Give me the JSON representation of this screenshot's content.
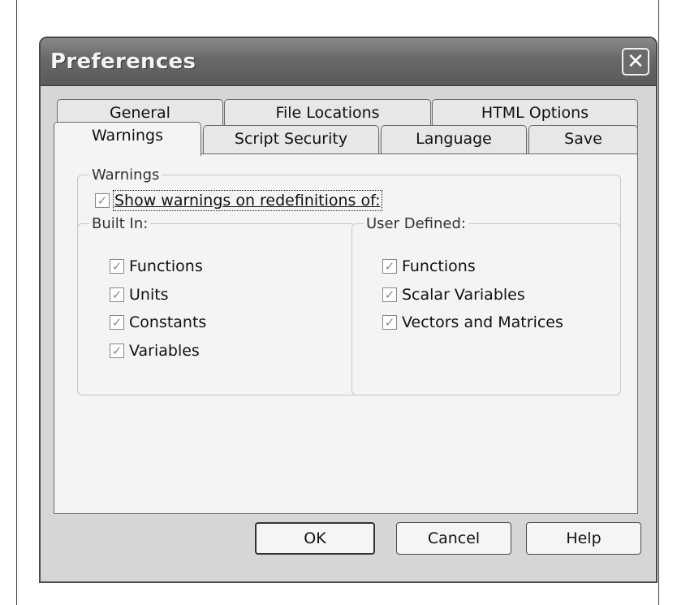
{
  "window": {
    "title": "Preferences"
  },
  "tabs": {
    "row1": [
      "General",
      "File Locations",
      "HTML Options"
    ],
    "row2": [
      "Warnings",
      "Script Security",
      "Language",
      "Save"
    ],
    "active": "Warnings"
  },
  "warnings": {
    "group_label": "Warnings",
    "show_label": "Show warnings on redefinitions of:",
    "show_checked": true,
    "built_in": {
      "label": "Built In:",
      "items": [
        {
          "label": "Functions",
          "accel": "F",
          "checked": true
        },
        {
          "label": "Units",
          "accel": "U",
          "checked": true
        },
        {
          "label": "Constants",
          "accel": "C",
          "checked": true
        },
        {
          "label": "Variables",
          "accel": "V",
          "checked": true
        }
      ]
    },
    "user_defined": {
      "label": "User Defined:",
      "items": [
        {
          "label": "Functions",
          "accel": "n",
          "checked": true
        },
        {
          "label": "Scalar Variables",
          "accel": "S",
          "checked": true
        },
        {
          "label": "Vectors and Matrices",
          "accel": "M",
          "checked": true
        }
      ]
    }
  },
  "buttons": {
    "ok": "OK",
    "cancel": "Cancel",
    "help": "Help"
  },
  "icons": {
    "check": "checkmark-icon",
    "close": "close-icon"
  }
}
